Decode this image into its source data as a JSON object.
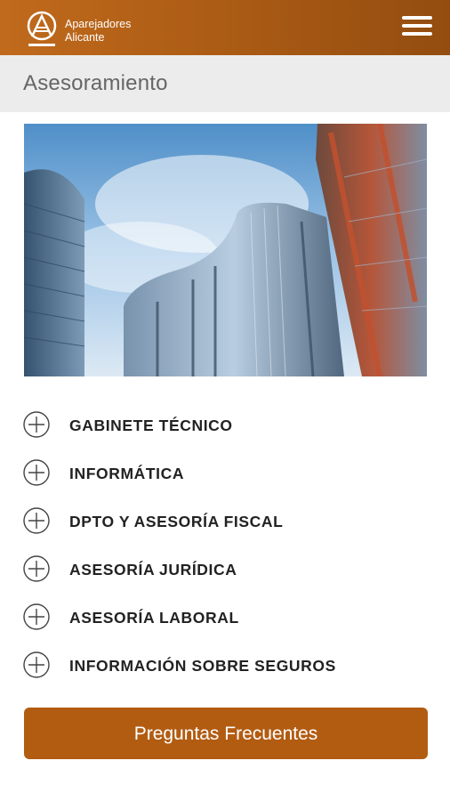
{
  "header": {
    "brand_line1": "Aparejadores",
    "brand_line2": "Alicante"
  },
  "page": {
    "title": "Asesoramiento"
  },
  "hero": {
    "description": ""
  },
  "accordion": {
    "items": [
      {
        "label": "GABINETE TÉCNICO"
      },
      {
        "label": "INFORMÁTICA"
      },
      {
        "label": "DPTO Y ASESORÍA FISCAL"
      },
      {
        "label": "ASESORÍA JURÍDICA"
      },
      {
        "label": "ASESORÍA LABORAL"
      },
      {
        "label": "INFORMACIÓN SOBRE SEGUROS"
      }
    ]
  },
  "cta": {
    "label": "Preguntas Frecuentes"
  },
  "colors": {
    "brand": "#b25c12",
    "header_dark": "#934d10",
    "title_bar": "#ececec"
  }
}
